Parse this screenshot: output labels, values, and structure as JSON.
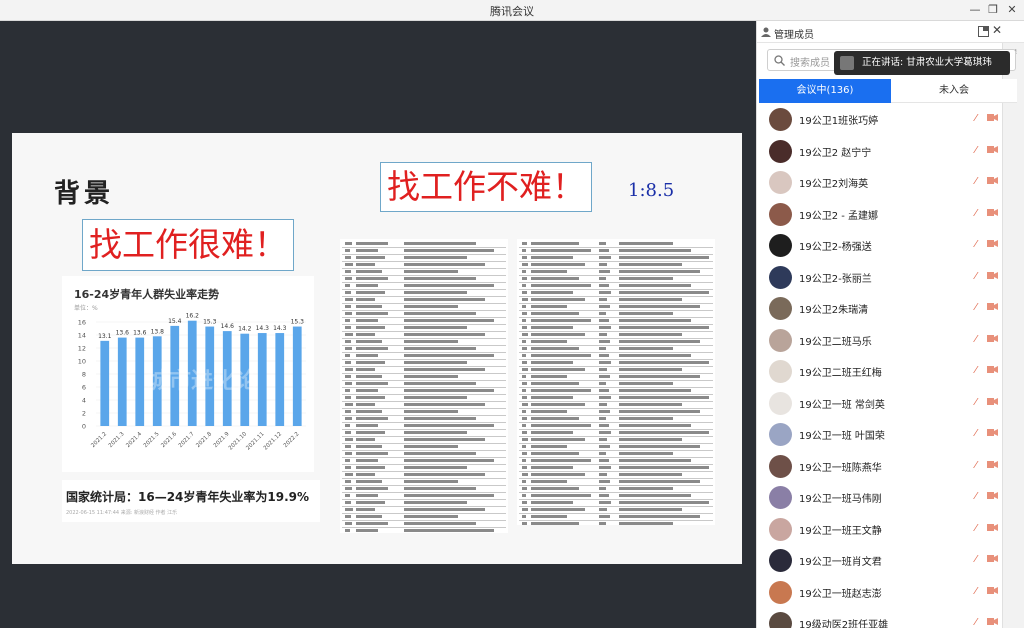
{
  "window": {
    "title": "腾讯会议"
  },
  "slide": {
    "heading": "背景",
    "hard_text": "找工作很难！",
    "easy_text": "找工作不难！",
    "ratio": "1:8.5",
    "caption": "国家统计局：16—24岁青年失业率为19.9%",
    "caption_meta": "2022-06-15 11:47:44  来源: 新浪财经  作者 江乐"
  },
  "chart_data": {
    "type": "bar",
    "title": "16-24岁青年人群失业率走势",
    "unit": "单位：%",
    "categories": [
      "2021.2",
      "2021.3",
      "2021.4",
      "2021.5",
      "2021.6",
      "2021.7",
      "2021.8",
      "2021.9",
      "2021.10",
      "2021.11",
      "2021.12",
      "2022.2"
    ],
    "values": [
      13.1,
      13.6,
      13.6,
      13.8,
      15.4,
      16.2,
      15.3,
      14.6,
      14.2,
      14.3,
      14.3,
      15.3
    ],
    "yticks": [
      0,
      2,
      4,
      6,
      8,
      10,
      12,
      14,
      16
    ],
    "ylim": [
      0,
      16
    ],
    "color": "#5aa6ea",
    "watermark": "城市进化论"
  },
  "panel": {
    "title": "管理成员",
    "search_placeholder": "搜索成员",
    "speaking": "正在讲话: 甘肃农业大学葛琪玮",
    "tab_in_meeting": "会议中(136)",
    "tab_not_joined": "未入会",
    "members": [
      {
        "name": "19公卫1班张巧婷",
        "color": "#6b4b3e"
      },
      {
        "name": "19公卫2 赵宁宁",
        "color": "#4a2c2a"
      },
      {
        "name": "19公卫2刘海英",
        "color": "#d9c7c0"
      },
      {
        "name": "19公卫2 - 孟建娜",
        "color": "#8c5a4a"
      },
      {
        "name": "19公卫2-杨强送",
        "color": "#1e1e1e"
      },
      {
        "name": "19公卫2-张丽兰",
        "color": "#2e3a5a"
      },
      {
        "name": "19公卫2朱瑞清",
        "color": "#7a6a5a"
      },
      {
        "name": "19公卫二班马乐",
        "color": "#b9a49a"
      },
      {
        "name": "19公卫二班王红梅",
        "color": "#e0d8d0"
      },
      {
        "name": "19公卫一班 常剑英",
        "color": "#e8e4e0"
      },
      {
        "name": "19公卫一班 叶国荣",
        "color": "#9aa5c4"
      },
      {
        "name": "19公卫一班陈燕华",
        "color": "#6e5048"
      },
      {
        "name": "19公卫一班马伟刚",
        "color": "#8a7fa6"
      },
      {
        "name": "19公卫一班王文静",
        "color": "#c9a6a0"
      },
      {
        "name": "19公卫一班肖文君",
        "color": "#2a2a3a"
      },
      {
        "name": "19公卫一班赵志澎",
        "color": "#c87850"
      },
      {
        "name": "19级动医2班任亚雄",
        "color": "#5a4a40"
      }
    ]
  }
}
